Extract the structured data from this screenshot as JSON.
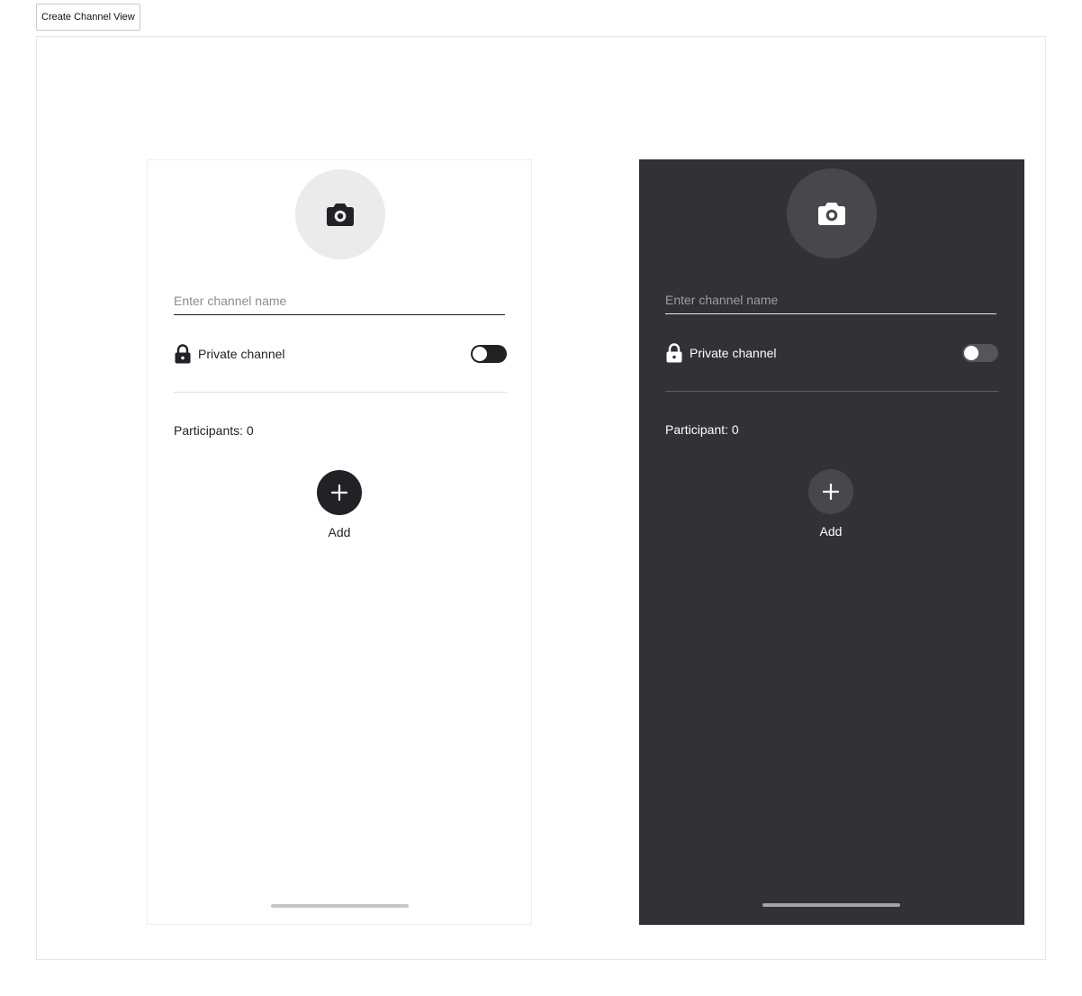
{
  "story_tab": {
    "label": "Create Channel View"
  },
  "colors": {
    "light_background": "#ffffff",
    "dark_background": "#323135",
    "dark_foreground": "#222226",
    "light_foreground": "#ffffff"
  },
  "light": {
    "avatar_icon": "camera-icon",
    "channel_name_placeholder": "Enter channel name",
    "channel_name_value": "",
    "private_label": "Private channel",
    "private_icon": "lock-icon",
    "private_enabled": false,
    "participants_label": "Participants: 0",
    "add_icon": "plus-icon",
    "add_label": "Add"
  },
  "dark": {
    "avatar_icon": "camera-icon",
    "channel_name_placeholder": "Enter channel name",
    "channel_name_value": "",
    "private_label": "Private channel",
    "private_icon": "lock-icon",
    "private_enabled": false,
    "participants_label": "Participant: 0",
    "add_icon": "plus-icon",
    "add_label": "Add"
  }
}
